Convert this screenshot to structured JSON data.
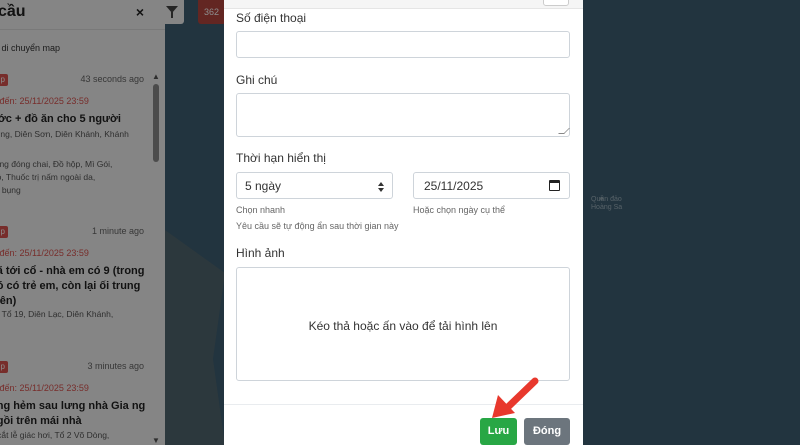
{
  "sidebar": {
    "title": "cầu",
    "close_icon": "×",
    "hint": "ại di chuyển map",
    "items": [
      {
        "badge": "p",
        "time": "43 seconds ago",
        "deadline": "hị đến: 25/11/2025 23:59",
        "title": "ước + đồ ăn cho 5 người",
        "address_lines": [
          "Vòng, Diên Sơn, Diên Khánh, Khánh"
        ],
        "needs_lines": [
          "uống đóng chai, Đồ hộp, Mì Gói,",
          "gió, Thuốc trị nấm ngoài da,",
          "ều bụng"
        ]
      },
      {
        "badge": "p",
        "time": "1 minute ago",
        "deadline": "hị đến: 25/11/2025 23:59",
        "title": "đã tới cổ - nhà em có 9 (trong đó có trẻ em, còn lại ối trung niên)",
        "address_lines": [
          "ng Tổ 19, Diên Lạc, Diên Khánh,",
          "òa"
        ],
        "needs_lines": []
      },
      {
        "badge": "p",
        "time": "3 minutes ago",
        "deadline": "hị đến: 25/11/2025 23:59",
        "title": "ong hẻm sau lưng nhà Gia ng ngồi trên mái nhà",
        "address_lines": [
          "ệ cắt lễ giác hơi, Tổ 2 Võ Dòng,"
        ],
        "needs_lines": []
      }
    ]
  },
  "map_controls": {
    "filter_icon": "filter-icon",
    "count_label": "362"
  },
  "map": {
    "island_label_lines": [
      "Quần đảo",
      "Hoàng Sa"
    ]
  },
  "form": {
    "phone_label": "Số điện thoại",
    "phone_value": "",
    "note_label": "Ghi chú",
    "note_value": "",
    "display_duration_label": "Thời hạn hiển thị",
    "quick_select_value": "5 ngày",
    "quick_select_help": "Chọn nhanh",
    "date_value": "25/11/2025",
    "date_help": "Hoặc chọn ngày cụ thể",
    "auto_hide_help": "Yêu cầu sẽ tự động ẩn sau thời gian này",
    "image_label": "Hình ảnh",
    "dropzone_text": "Kéo thả hoặc ấn vào để tải hình lên"
  },
  "footer": {
    "save_label": "Lưu",
    "close_label": "Đóng"
  },
  "colors": {
    "save": "#28a745",
    "close": "#6c757d",
    "badge": "#d9534f",
    "arrow": "#e8382d",
    "count": "#b5453f"
  }
}
